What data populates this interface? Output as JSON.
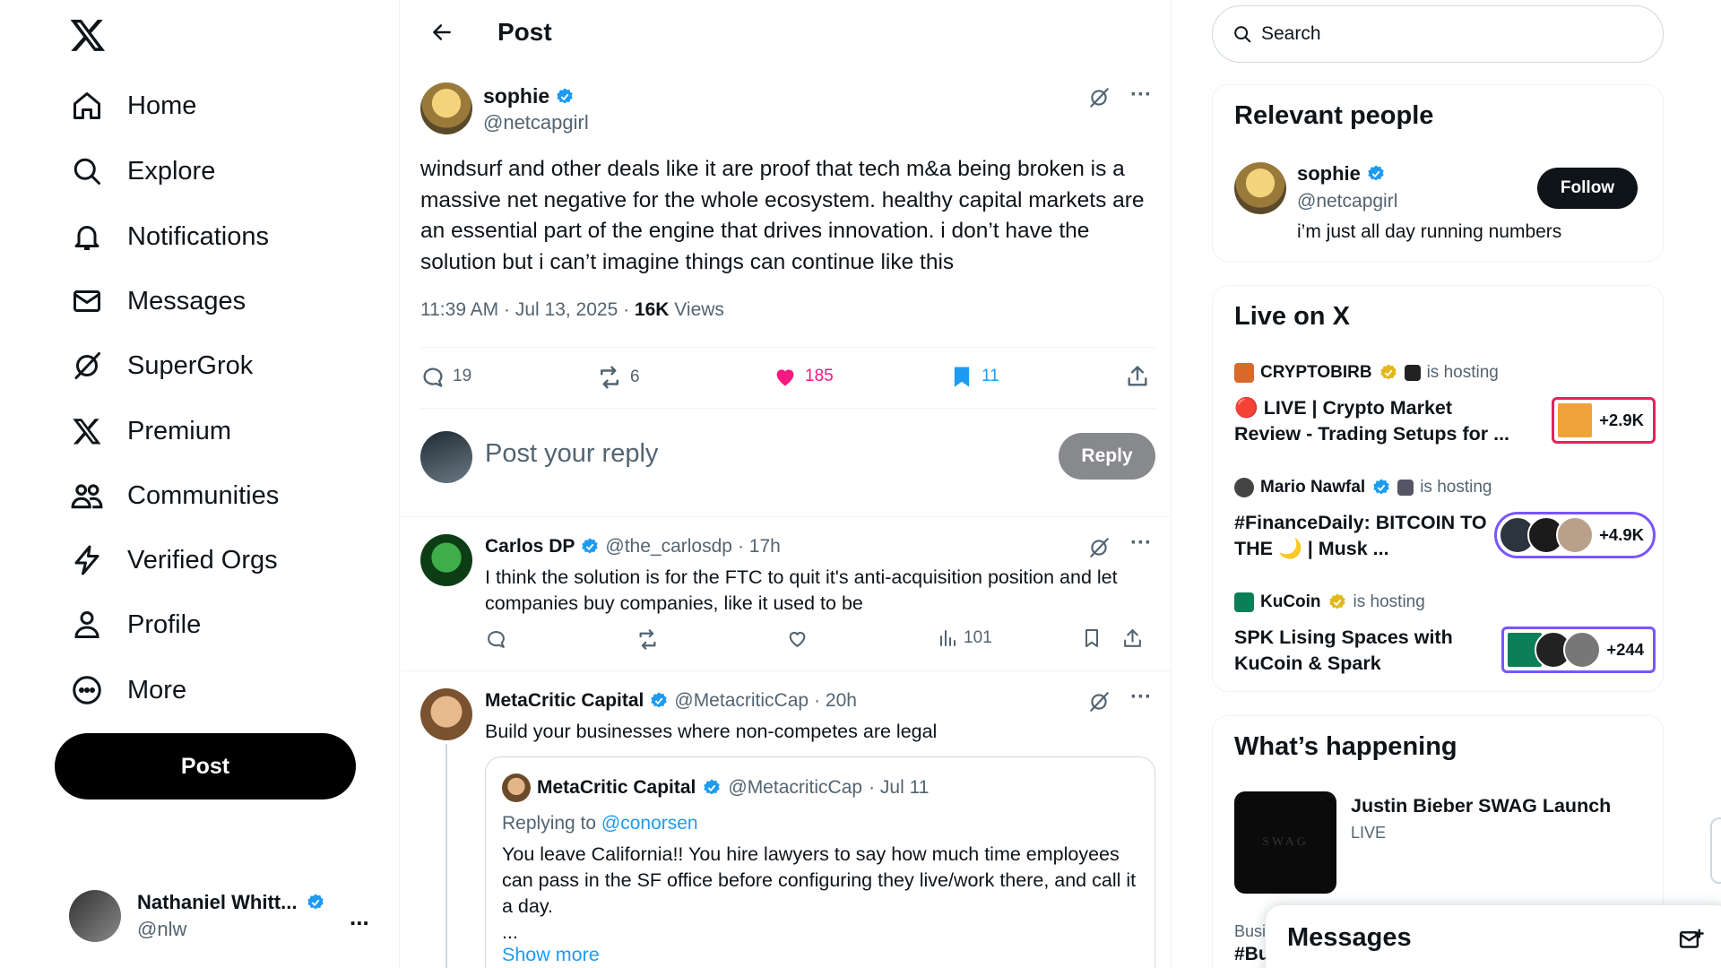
{
  "nav": {
    "items": [
      {
        "label": "Home",
        "icon": "home-icon"
      },
      {
        "label": "Explore",
        "icon": "search-icon"
      },
      {
        "label": "Notifications",
        "icon": "bell-icon"
      },
      {
        "label": "Messages",
        "icon": "mail-icon"
      },
      {
        "label": "SuperGrok",
        "icon": "grok-icon"
      },
      {
        "label": "Premium",
        "icon": "x-icon"
      },
      {
        "label": "Communities",
        "icon": "people-icon"
      },
      {
        "label": "Verified Orgs",
        "icon": "lightning-icon"
      },
      {
        "label": "Profile",
        "icon": "person-icon"
      },
      {
        "label": "More",
        "icon": "more-circle-icon"
      }
    ],
    "post_label": "Post",
    "account": {
      "name": "Nathaniel Whitt...",
      "handle": "@nlw",
      "more": "..."
    }
  },
  "header": {
    "title": "Post"
  },
  "tweet": {
    "name": "sophie",
    "handle": "@netcapgirl",
    "body": "windsurf and other deals like it are proof that tech m&a being broken is a massive net negative for the whole ecosystem. healthy capital markets are an essential part of the engine that drives innovation. i don’t have the solution but i can’t imagine things can continue like this",
    "time": "11:39 AM · Jul 13, 2025 · ",
    "views": "16K",
    "views_label": " Views",
    "replies": "19",
    "reposts": "6",
    "likes": "185",
    "bookmarks": "11",
    "more": "···"
  },
  "reply_box": {
    "placeholder": "Post your reply",
    "button": "Reply"
  },
  "comments": [
    {
      "name": "Carlos DP",
      "handle": "@the_carlosdp",
      "time": "· 17h",
      "text": "I think the solution is for the FTC to quit it's anti-acquisition position and let companies buy companies, like it used to be",
      "views": "101",
      "more": "···"
    },
    {
      "name": "MetaCritic Capital",
      "handle": "@MetacriticCap",
      "time": "· 20h",
      "text": "Build your businesses where non-competes are legal",
      "more": "···",
      "quote": {
        "name": "MetaCritic Capital",
        "handle": "@MetacriticCap",
        "time": "· Jul 11",
        "replying_prefix": "Replying to ",
        "replying_to": "@conorsen",
        "text": "You leave California!! You hire lawyers to say how much time employees can pass in the SF office before configuring they live/work there, and call it a day.",
        "ellipsis": "...",
        "show_more": "Show more"
      }
    }
  ],
  "search": {
    "placeholder": "Search"
  },
  "relevant": {
    "title": "Relevant people",
    "name": "sophie",
    "handle": "@netcapgirl",
    "bio": "i’m just all day running numbers",
    "follow": "Follow"
  },
  "live": {
    "title": "Live on X",
    "items": [
      {
        "host": "CRYPTOBIRB",
        "hosting": "is hosting",
        "title": "🔴 LIVE | Crypto Market Review - Trading Setups for ...",
        "count": "+2.9K",
        "accent": "#e0245e"
      },
      {
        "host": "Mario Nawfal",
        "hosting": "is hosting",
        "title": "#FinanceDaily: BITCOIN TO THE 🌙 | Musk ...",
        "count": "+4.9K",
        "accent": "#7856ff"
      },
      {
        "host": "KuCoin",
        "hosting": "is hosting",
        "title": "SPK Lising Spaces with KuCoin & Spark",
        "count": "+244",
        "accent": "#7856ff"
      }
    ]
  },
  "happening": {
    "title": "What’s happening",
    "item_title": "Justin Bieber SWAG Launch",
    "item_sub": "LIVE",
    "image_text": "SWAG",
    "cut_sub": "Busi",
    "cut_title": "#Bu"
  },
  "messages_drawer": {
    "title": "Messages"
  },
  "colors": {
    "verified": "#1d9bf0",
    "like": "#f91880",
    "bookmark": "#1d9bf0",
    "gold": "#e2b719"
  }
}
